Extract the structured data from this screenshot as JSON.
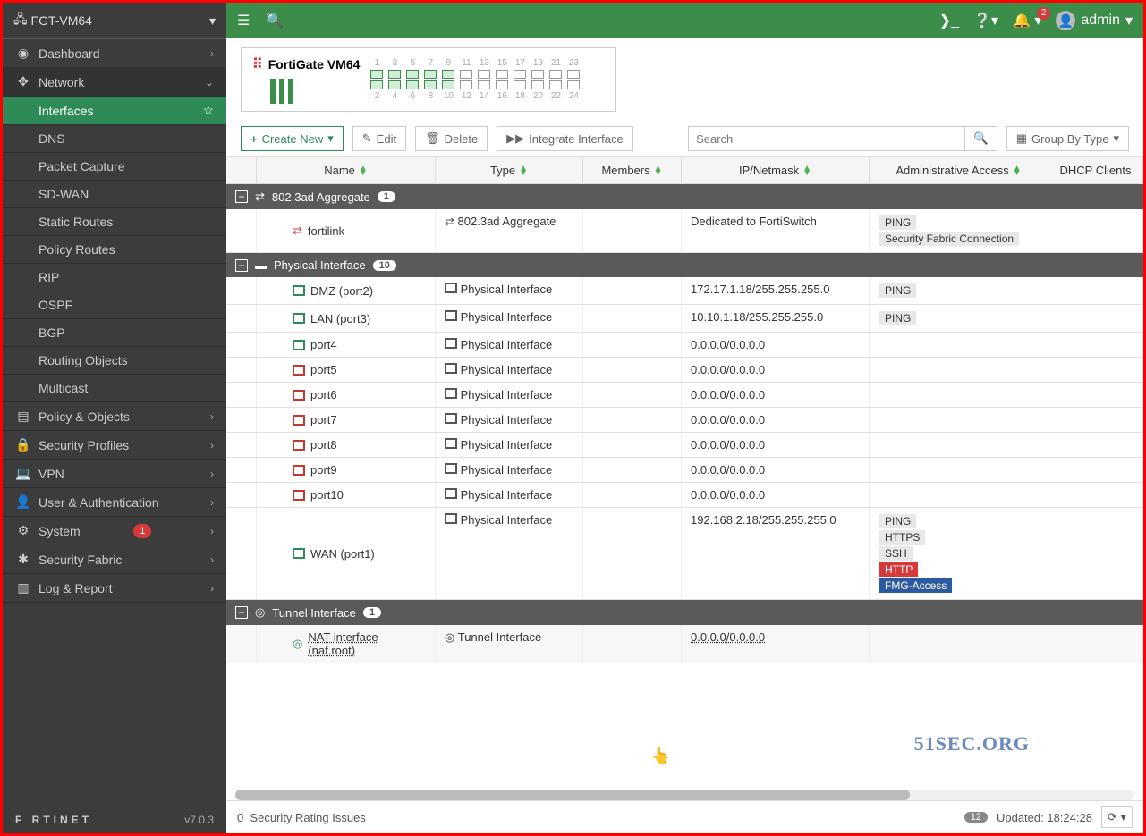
{
  "device_name": "FGT-VM64",
  "topbar": {
    "user": "admin",
    "notif_count": "2"
  },
  "sidebar": {
    "dashboard": "Dashboard",
    "network": "Network",
    "network_children": {
      "interfaces": "Interfaces",
      "dns": "DNS",
      "packet_capture": "Packet Capture",
      "sdwan": "SD-WAN",
      "static_routes": "Static Routes",
      "policy_routes": "Policy Routes",
      "rip": "RIP",
      "ospf": "OSPF",
      "bgp": "BGP",
      "routing_objects": "Routing Objects",
      "multicast": "Multicast"
    },
    "policy_objects": "Policy & Objects",
    "security_profiles": "Security Profiles",
    "vpn": "VPN",
    "user_auth": "User & Authentication",
    "system": "System",
    "system_badge": "1",
    "security_fabric": "Security Fabric",
    "log_report": "Log & Report",
    "brand": "F   RTINET",
    "version": "v7.0.3"
  },
  "device_status": {
    "title": "FortiGate VM64",
    "top_nums": [
      "1",
      "3",
      "5",
      "7",
      "9",
      "11",
      "13",
      "15",
      "17",
      "19",
      "21",
      "23"
    ],
    "bot_nums": [
      "2",
      "4",
      "6",
      "8",
      "10",
      "12",
      "14",
      "16",
      "18",
      "20",
      "22",
      "24"
    ]
  },
  "toolbar": {
    "create_new": "Create New",
    "edit": "Edit",
    "delete": "Delete",
    "integrate": "Integrate Interface",
    "search_placeholder": "Search",
    "group_by": "Group By Type"
  },
  "columns": {
    "name": "Name",
    "type": "Type",
    "members": "Members",
    "ip": "IP/Netmask",
    "admin": "Administrative Access",
    "dhcp": "DHCP Clients"
  },
  "groups": {
    "aggregate": {
      "label": "802.3ad Aggregate",
      "count": "1"
    },
    "physical": {
      "label": "Physical Interface",
      "count": "10"
    },
    "tunnel": {
      "label": "Tunnel Interface",
      "count": "1"
    }
  },
  "rows": {
    "fortilink": {
      "name": "fortilink",
      "type": "802.3ad Aggregate",
      "ip": "Dedicated to FortiSwitch",
      "access": [
        "PING",
        "Security Fabric Connection"
      ]
    },
    "dmz": {
      "name": "DMZ (port2)",
      "type": "Physical Interface",
      "ip": "172.17.1.18/255.255.255.0",
      "access": [
        "PING"
      ]
    },
    "lan": {
      "name": "LAN (port3)",
      "type": "Physical Interface",
      "ip": "10.10.1.18/255.255.255.0",
      "access": [
        "PING"
      ]
    },
    "port4": {
      "name": "port4",
      "type": "Physical Interface",
      "ip": "0.0.0.0/0.0.0.0"
    },
    "port5": {
      "name": "port5",
      "type": "Physical Interface",
      "ip": "0.0.0.0/0.0.0.0"
    },
    "port6": {
      "name": "port6",
      "type": "Physical Interface",
      "ip": "0.0.0.0/0.0.0.0"
    },
    "port7": {
      "name": "port7",
      "type": "Physical Interface",
      "ip": "0.0.0.0/0.0.0.0"
    },
    "port8": {
      "name": "port8",
      "type": "Physical Interface",
      "ip": "0.0.0.0/0.0.0.0"
    },
    "port9": {
      "name": "port9",
      "type": "Physical Interface",
      "ip": "0.0.0.0/0.0.0.0"
    },
    "port10": {
      "name": "port10",
      "type": "Physical Interface",
      "ip": "0.0.0.0/0.0.0.0"
    },
    "wan": {
      "name": "WAN (port1)",
      "type": "Physical Interface",
      "ip": "192.168.2.18/255.255.255.0",
      "access": [
        "PING",
        "HTTPS",
        "SSH",
        "HTTP",
        "FMG-Access"
      ]
    },
    "nat": {
      "name": "NAT interface (naf.root)",
      "type": "Tunnel Interface",
      "ip": "0.0.0.0/0.0.0.0"
    }
  },
  "statusbar": {
    "issues_zero": "0",
    "issues_label": "Security Rating Issues",
    "percent": "12",
    "updated_label": "Updated:",
    "updated_time": "18:24:28"
  },
  "watermark": "51SEC.ORG"
}
